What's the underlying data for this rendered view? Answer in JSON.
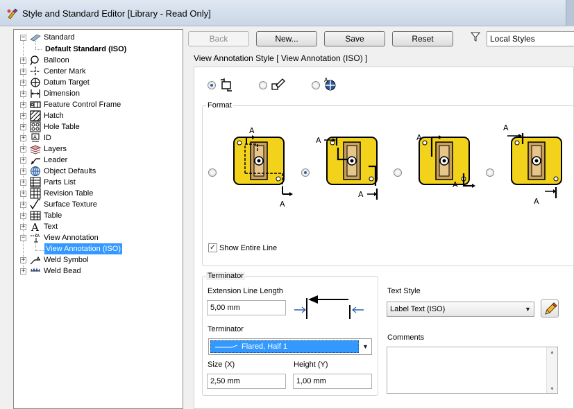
{
  "window": {
    "title": "Style and Standard Editor [Library - Read Only]"
  },
  "tree": {
    "root": "Standard",
    "default_standard": "Default Standard (ISO)",
    "items": [
      {
        "label": "Balloon",
        "icon": "balloon-icon"
      },
      {
        "label": "Center Mark",
        "icon": "center-mark-icon"
      },
      {
        "label": "Datum Target",
        "icon": "datum-target-icon"
      },
      {
        "label": "Dimension",
        "icon": "dimension-icon"
      },
      {
        "label": "Feature Control Frame",
        "icon": "feature-control-frame-icon"
      },
      {
        "label": "Hatch",
        "icon": "hatch-icon"
      },
      {
        "label": "Hole Table",
        "icon": "hole-table-icon"
      },
      {
        "label": "ID",
        "icon": "id-icon"
      },
      {
        "label": "Layers",
        "icon": "layers-icon"
      },
      {
        "label": "Leader",
        "icon": "leader-icon"
      },
      {
        "label": "Object Defaults",
        "icon": "object-defaults-icon"
      },
      {
        "label": "Parts List",
        "icon": "parts-list-icon"
      },
      {
        "label": "Revision Table",
        "icon": "revision-table-icon"
      },
      {
        "label": "Surface Texture",
        "icon": "surface-texture-icon"
      },
      {
        "label": "Table",
        "icon": "table-icon"
      },
      {
        "label": "Text",
        "icon": "text-icon"
      },
      {
        "label": "View Annotation",
        "icon": "view-annotation-icon"
      },
      {
        "label": "Weld Symbol",
        "icon": "weld-symbol-icon"
      },
      {
        "label": "Weld Bead",
        "icon": "weld-bead-icon"
      }
    ],
    "selected_child": "View Annotation (ISO)"
  },
  "toolbar": {
    "back": "Back",
    "new": "New...",
    "save": "Save",
    "reset": "Reset",
    "filter_value": "Local Styles"
  },
  "style_header": "View Annotation Style [ View Annotation (ISO) ]",
  "format": {
    "title": "Format",
    "selected_option_index": 1,
    "letter": "A",
    "show_entire_line_label": "Show Entire Line",
    "show_entire_line_checked": true
  },
  "terminator": {
    "group_title": "Terminator",
    "extension_line_length_label": "Extension Line Length",
    "extension_line_length_value": "5,00 mm",
    "terminator_label": "Terminator",
    "terminator_value": "Flared, Half 1",
    "size_label": "Size (X)",
    "size_value": "2,50 mm",
    "height_label": "Height (Y)",
    "height_value": "1,00 mm"
  },
  "text_style": {
    "label": "Text Style",
    "value": "Label Text (ISO)"
  },
  "comments": {
    "label": "Comments",
    "value": ""
  },
  "colors": {
    "accent": "#3399ff",
    "selection": "#3399ff",
    "symbol_fill": "#f2d21a",
    "symbol_inner": "#c8a05a"
  }
}
